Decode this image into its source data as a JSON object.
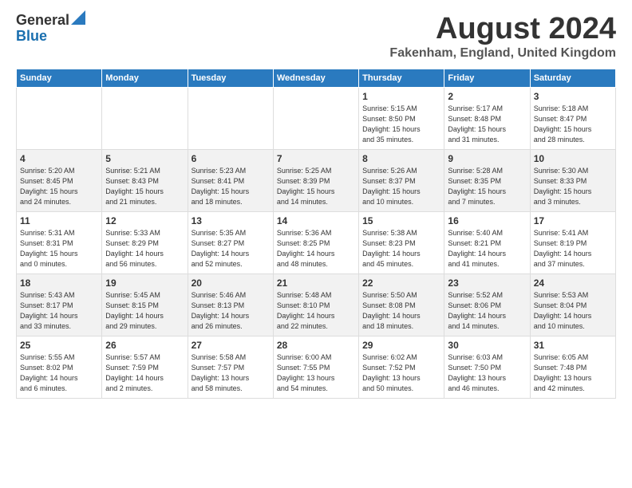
{
  "logo": {
    "general": "General",
    "blue": "Blue"
  },
  "title": {
    "month_year": "August 2024",
    "location": "Fakenham, England, United Kingdom"
  },
  "weekdays": [
    "Sunday",
    "Monday",
    "Tuesday",
    "Wednesday",
    "Thursday",
    "Friday",
    "Saturday"
  ],
  "weeks": [
    [
      {
        "day": "",
        "info": ""
      },
      {
        "day": "",
        "info": ""
      },
      {
        "day": "",
        "info": ""
      },
      {
        "day": "",
        "info": ""
      },
      {
        "day": "1",
        "info": "Sunrise: 5:15 AM\nSunset: 8:50 PM\nDaylight: 15 hours\nand 35 minutes."
      },
      {
        "day": "2",
        "info": "Sunrise: 5:17 AM\nSunset: 8:48 PM\nDaylight: 15 hours\nand 31 minutes."
      },
      {
        "day": "3",
        "info": "Sunrise: 5:18 AM\nSunset: 8:47 PM\nDaylight: 15 hours\nand 28 minutes."
      }
    ],
    [
      {
        "day": "4",
        "info": "Sunrise: 5:20 AM\nSunset: 8:45 PM\nDaylight: 15 hours\nand 24 minutes."
      },
      {
        "day": "5",
        "info": "Sunrise: 5:21 AM\nSunset: 8:43 PM\nDaylight: 15 hours\nand 21 minutes."
      },
      {
        "day": "6",
        "info": "Sunrise: 5:23 AM\nSunset: 8:41 PM\nDaylight: 15 hours\nand 18 minutes."
      },
      {
        "day": "7",
        "info": "Sunrise: 5:25 AM\nSunset: 8:39 PM\nDaylight: 15 hours\nand 14 minutes."
      },
      {
        "day": "8",
        "info": "Sunrise: 5:26 AM\nSunset: 8:37 PM\nDaylight: 15 hours\nand 10 minutes."
      },
      {
        "day": "9",
        "info": "Sunrise: 5:28 AM\nSunset: 8:35 PM\nDaylight: 15 hours\nand 7 minutes."
      },
      {
        "day": "10",
        "info": "Sunrise: 5:30 AM\nSunset: 8:33 PM\nDaylight: 15 hours\nand 3 minutes."
      }
    ],
    [
      {
        "day": "11",
        "info": "Sunrise: 5:31 AM\nSunset: 8:31 PM\nDaylight: 15 hours\nand 0 minutes."
      },
      {
        "day": "12",
        "info": "Sunrise: 5:33 AM\nSunset: 8:29 PM\nDaylight: 14 hours\nand 56 minutes."
      },
      {
        "day": "13",
        "info": "Sunrise: 5:35 AM\nSunset: 8:27 PM\nDaylight: 14 hours\nand 52 minutes."
      },
      {
        "day": "14",
        "info": "Sunrise: 5:36 AM\nSunset: 8:25 PM\nDaylight: 14 hours\nand 48 minutes."
      },
      {
        "day": "15",
        "info": "Sunrise: 5:38 AM\nSunset: 8:23 PM\nDaylight: 14 hours\nand 45 minutes."
      },
      {
        "day": "16",
        "info": "Sunrise: 5:40 AM\nSunset: 8:21 PM\nDaylight: 14 hours\nand 41 minutes."
      },
      {
        "day": "17",
        "info": "Sunrise: 5:41 AM\nSunset: 8:19 PM\nDaylight: 14 hours\nand 37 minutes."
      }
    ],
    [
      {
        "day": "18",
        "info": "Sunrise: 5:43 AM\nSunset: 8:17 PM\nDaylight: 14 hours\nand 33 minutes."
      },
      {
        "day": "19",
        "info": "Sunrise: 5:45 AM\nSunset: 8:15 PM\nDaylight: 14 hours\nand 29 minutes."
      },
      {
        "day": "20",
        "info": "Sunrise: 5:46 AM\nSunset: 8:13 PM\nDaylight: 14 hours\nand 26 minutes."
      },
      {
        "day": "21",
        "info": "Sunrise: 5:48 AM\nSunset: 8:10 PM\nDaylight: 14 hours\nand 22 minutes."
      },
      {
        "day": "22",
        "info": "Sunrise: 5:50 AM\nSunset: 8:08 PM\nDaylight: 14 hours\nand 18 minutes."
      },
      {
        "day": "23",
        "info": "Sunrise: 5:52 AM\nSunset: 8:06 PM\nDaylight: 14 hours\nand 14 minutes."
      },
      {
        "day": "24",
        "info": "Sunrise: 5:53 AM\nSunset: 8:04 PM\nDaylight: 14 hours\nand 10 minutes."
      }
    ],
    [
      {
        "day": "25",
        "info": "Sunrise: 5:55 AM\nSunset: 8:02 PM\nDaylight: 14 hours\nand 6 minutes."
      },
      {
        "day": "26",
        "info": "Sunrise: 5:57 AM\nSunset: 7:59 PM\nDaylight: 14 hours\nand 2 minutes."
      },
      {
        "day": "27",
        "info": "Sunrise: 5:58 AM\nSunset: 7:57 PM\nDaylight: 13 hours\nand 58 minutes."
      },
      {
        "day": "28",
        "info": "Sunrise: 6:00 AM\nSunset: 7:55 PM\nDaylight: 13 hours\nand 54 minutes."
      },
      {
        "day": "29",
        "info": "Sunrise: 6:02 AM\nSunset: 7:52 PM\nDaylight: 13 hours\nand 50 minutes."
      },
      {
        "day": "30",
        "info": "Sunrise: 6:03 AM\nSunset: 7:50 PM\nDaylight: 13 hours\nand 46 minutes."
      },
      {
        "day": "31",
        "info": "Sunrise: 6:05 AM\nSunset: 7:48 PM\nDaylight: 13 hours\nand 42 minutes."
      }
    ]
  ]
}
